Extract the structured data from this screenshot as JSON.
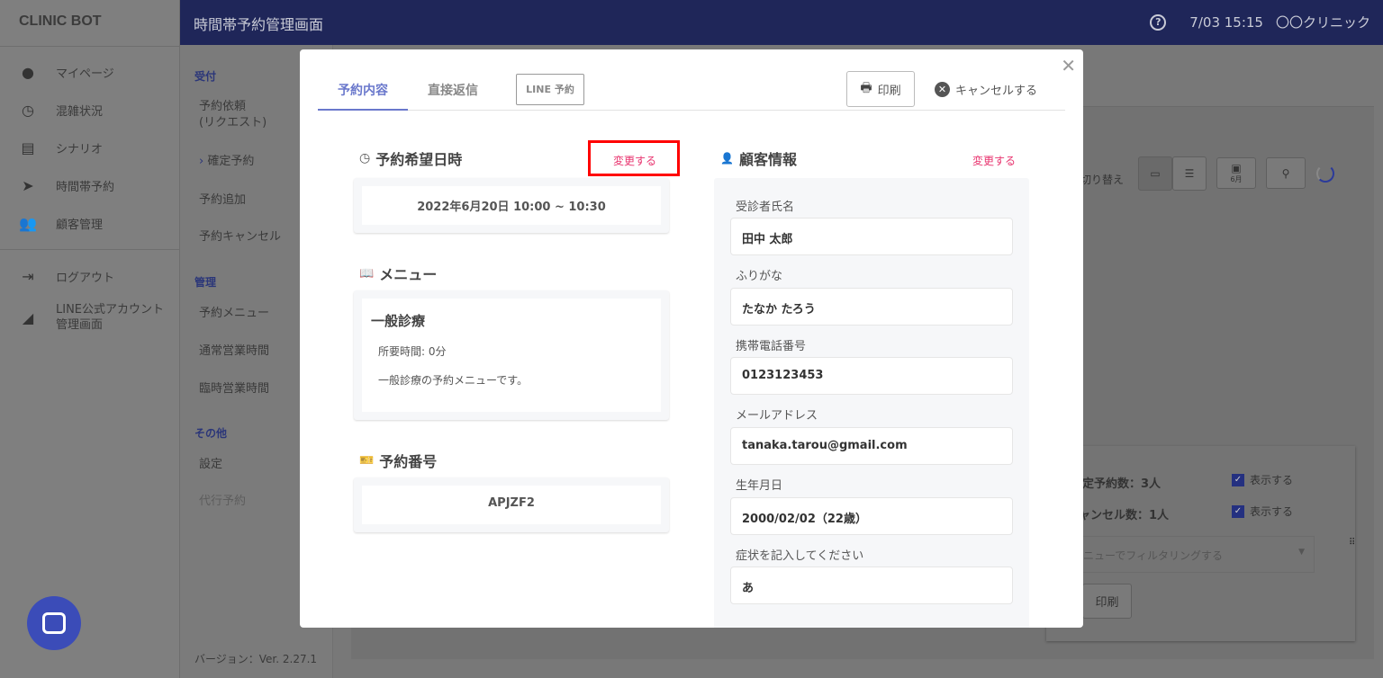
{
  "brand": "CLINIC BOT",
  "header": {
    "title": "時間帯予約管理画面",
    "datetime": "7/03 15:15",
    "clinic": "〇〇クリニック"
  },
  "sidebar": {
    "items": [
      {
        "label": "マイページ",
        "icon": "account-circle-icon"
      },
      {
        "label": "混雑状況",
        "icon": "clock-icon"
      },
      {
        "label": "シナリオ",
        "icon": "list-icon"
      },
      {
        "label": "時間帯予約",
        "icon": "send-icon"
      },
      {
        "label": "顧客管理",
        "icon": "people-icon"
      }
    ],
    "logout": "ログアウト",
    "line_admin_1": "LINE公式アカウント",
    "line_admin_2": "管理画面"
  },
  "subnav": {
    "sec1": "受付",
    "request_1": "予約依頼",
    "request_2": "(リクエスト)",
    "confirmed": "確定予約",
    "add": "予約追加",
    "cancel": "予約キャンセル",
    "sec2": "管理",
    "menu": "予約メニュー",
    "hours": "通常営業時間",
    "temp_hours": "臨時営業時間",
    "sec3": "その他",
    "settings": "設定",
    "proxy": "代行予約",
    "version": "バージョン：Ver. 2.27.1"
  },
  "background": {
    "switch_label": "切り替え",
    "month": "6月",
    "confirmed_count": "定予約数：3人",
    "cancel_count": "ャンセル数：1人",
    "show": "表示する",
    "filter_placeholder": "ニューでフィルタリングする",
    "print": "印刷"
  },
  "modal": {
    "tabs": [
      "予約内容",
      "直接返信",
      "LINE 予約"
    ],
    "print": "印刷",
    "cancel": "キャンセルする",
    "datetime_title": "予約希望日時",
    "edit": "変更する",
    "datetime_value": "2022年6月20日 10:00 ~ 10:30",
    "menu_title": "メニュー",
    "menu_name": "一般診療",
    "menu_duration": "所要時間: 0分",
    "menu_desc": "一般診療の予約メニューです。",
    "number_title": "予約番号",
    "number_value": "APJZF2",
    "customer_title": "顧客情報",
    "fields": [
      {
        "label": "受診者氏名",
        "value": "田中 太郎"
      },
      {
        "label": "ふりがな",
        "value": "たなか たろう"
      },
      {
        "label": "携帯電話番号",
        "value": "0123123453"
      },
      {
        "label": "メールアドレス",
        "value": "tanaka.tarou@gmail.com"
      },
      {
        "label": "生年月日",
        "value": "2000/02/02（22歳）"
      },
      {
        "label": "症状を記入してください",
        "value": "あ"
      }
    ]
  },
  "colors": {
    "header": "#1f2659",
    "accent": "#6a78cc",
    "edit": "#e8336e",
    "highlight": "#ff0000"
  }
}
